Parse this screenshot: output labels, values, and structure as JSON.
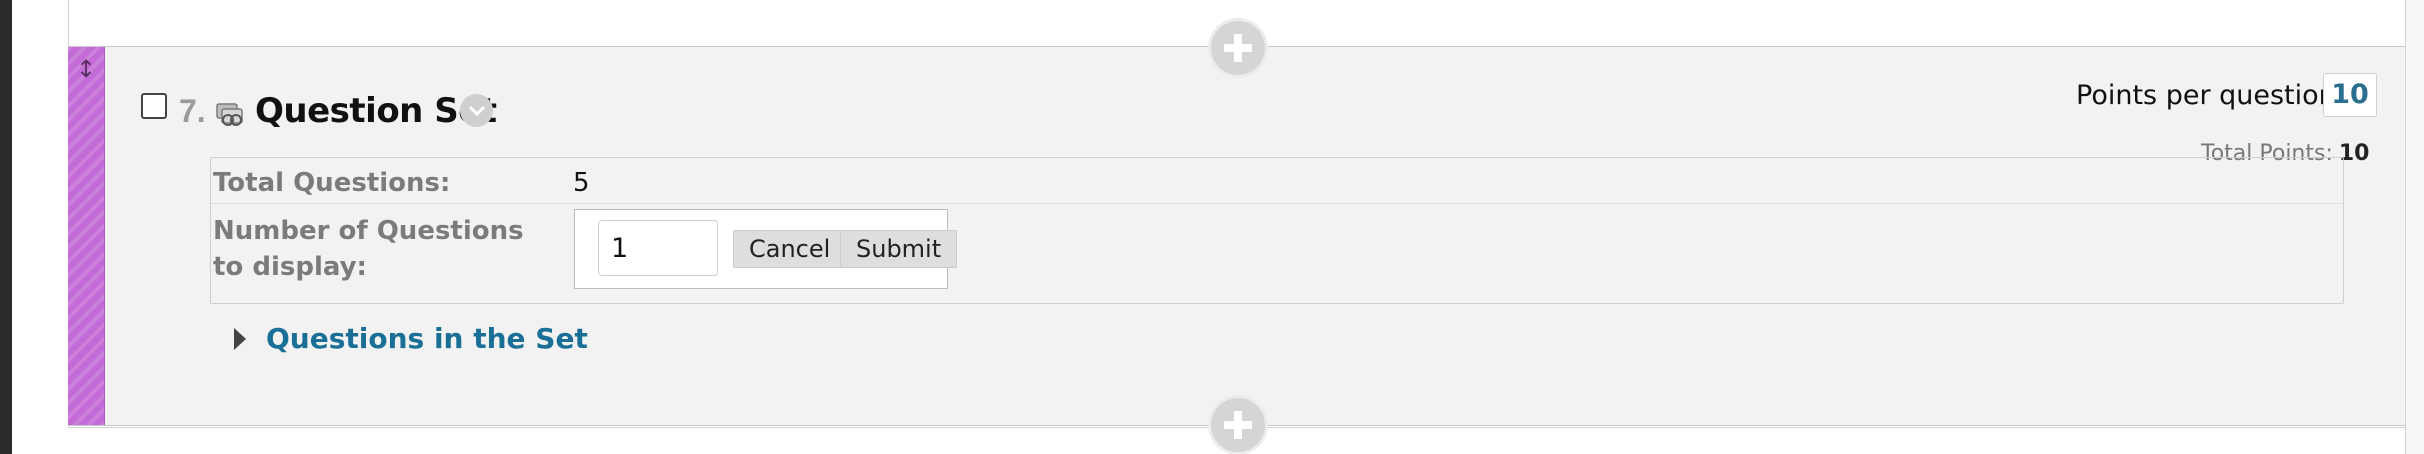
{
  "question": {
    "number": "7.",
    "title": "Question Set",
    "drag_icon_glyph": "↕",
    "icons": {
      "drag": "drag-handle-icon",
      "type": "question-set-icon",
      "options": "chevron-down-icon",
      "add": "add-icon",
      "expand": "triangle-right-icon"
    }
  },
  "points": {
    "per_question_label": "Points per question:",
    "per_question_value": "10",
    "total_label": "Total Points:",
    "total_value": "10"
  },
  "details": {
    "total_questions_label": "Total Questions:",
    "total_questions_value": "5",
    "display_label": "Number of Questions to display:",
    "display_value": "1",
    "cancel_label": "Cancel",
    "submit_label": "Submit"
  },
  "set_link": {
    "label": "Questions in the Set"
  },
  "colors": {
    "drag_bar": "#c36bd6",
    "link": "#1a6f96",
    "card_background": "#f2f2f2"
  }
}
